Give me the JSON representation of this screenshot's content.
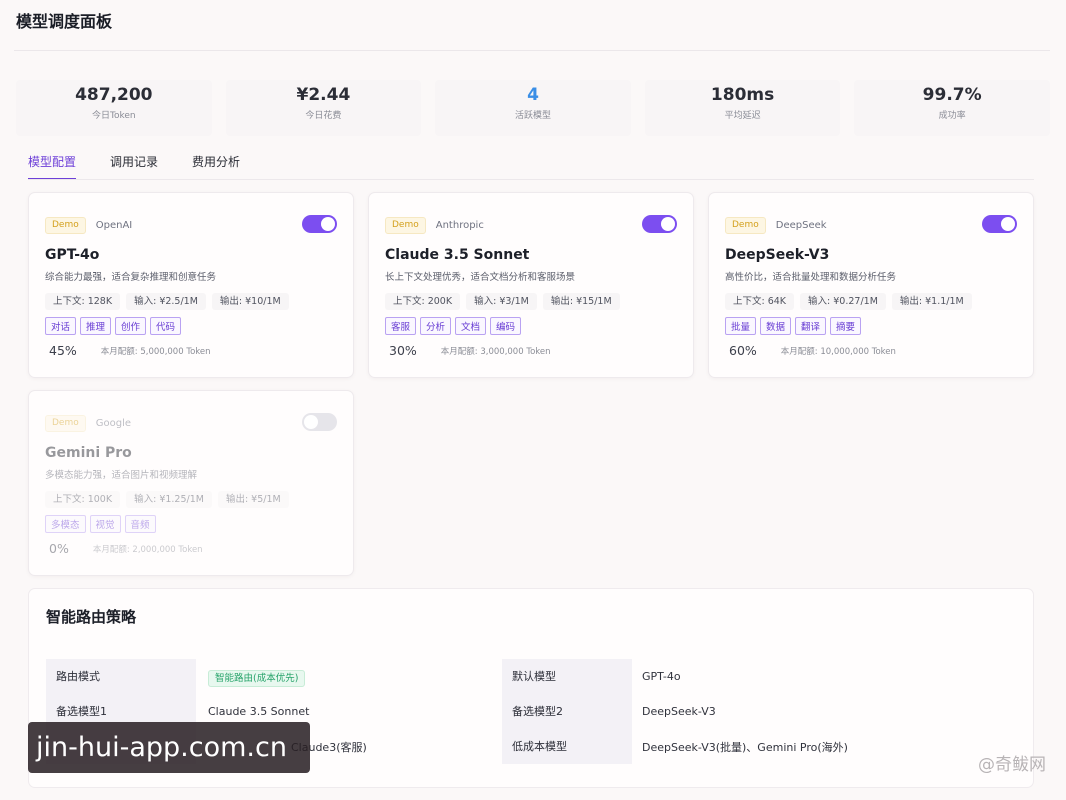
{
  "page": {
    "title": "模型调度面板"
  },
  "stats": [
    {
      "value": "487,200",
      "label": "今日Token"
    },
    {
      "value": "¥2.44",
      "label": "今日花费"
    },
    {
      "value": "4",
      "label": "活跃模型"
    },
    {
      "value": "180ms",
      "label": "平均延迟"
    },
    {
      "value": "99.7%",
      "label": "成功率"
    }
  ],
  "tabs": [
    {
      "label": "模型配置",
      "active": true
    },
    {
      "label": "调用记录",
      "active": false
    },
    {
      "label": "费用分析",
      "active": false
    }
  ],
  "models": [
    {
      "badge": "Demo",
      "provider": "OpenAI",
      "enabled": true,
      "name": "GPT-4o",
      "desc": "综合能力最强，适合复杂推理和创意任务",
      "specs": [
        "上下文: 128K",
        "输入: ¥2.5/1M",
        "输出: ¥10/1M"
      ],
      "tags": [
        "对话",
        "推理",
        "创作",
        "代码"
      ],
      "usage": "45%",
      "quota": "本月配额: 5,000,000 Token"
    },
    {
      "badge": "Demo",
      "provider": "Anthropic",
      "enabled": true,
      "name": "Claude 3.5 Sonnet",
      "desc": "长上下文处理优秀，适合文档分析和客服场景",
      "specs": [
        "上下文: 200K",
        "输入: ¥3/1M",
        "输出: ¥15/1M"
      ],
      "tags": [
        "客服",
        "分析",
        "文档",
        "编码"
      ],
      "usage": "30%",
      "quota": "本月配额: 3,000,000 Token"
    },
    {
      "badge": "Demo",
      "provider": "DeepSeek",
      "enabled": true,
      "name": "DeepSeek-V3",
      "desc": "高性价比，适合批量处理和数据分析任务",
      "specs": [
        "上下文: 64K",
        "输入: ¥0.27/1M",
        "输出: ¥1.1/1M"
      ],
      "tags": [
        "批量",
        "数据",
        "翻译",
        "摘要"
      ],
      "usage": "60%",
      "quota": "本月配额: 10,000,000 Token"
    },
    {
      "badge": "Demo",
      "provider": "Google",
      "enabled": false,
      "name": "Gemini Pro",
      "desc": "多模态能力强，适合图片和视频理解",
      "specs": [
        "上下文: 100K",
        "输入: ¥1.25/1M",
        "输出: ¥5/1M"
      ],
      "tags": [
        "多模态",
        "视觉",
        "音频"
      ],
      "usage": "0%",
      "quota": "本月配额: 2,000,000 Token"
    }
  ],
  "routing": {
    "title": "智能路由策略",
    "rows": [
      {
        "k1": "路由模式",
        "v1": "智能路由(成本优先)",
        "k2": "默认模型",
        "v2": "GPT-4o"
      },
      {
        "k1": "备选模型1",
        "v1": "Claude 3.5 Sonnet",
        "k2": "备选模型2",
        "v2": "DeepSeek-V3"
      },
      {
        "k1": "",
        "v1": "Claude3(客服)",
        "k2": "低成本模型",
        "v2": "DeepSeek-V3(批量)、Gemini Pro(海外)"
      }
    ]
  },
  "overlay": {
    "watermark": "jin-hui-app.com.cn",
    "corner": "@奇鲅网"
  }
}
